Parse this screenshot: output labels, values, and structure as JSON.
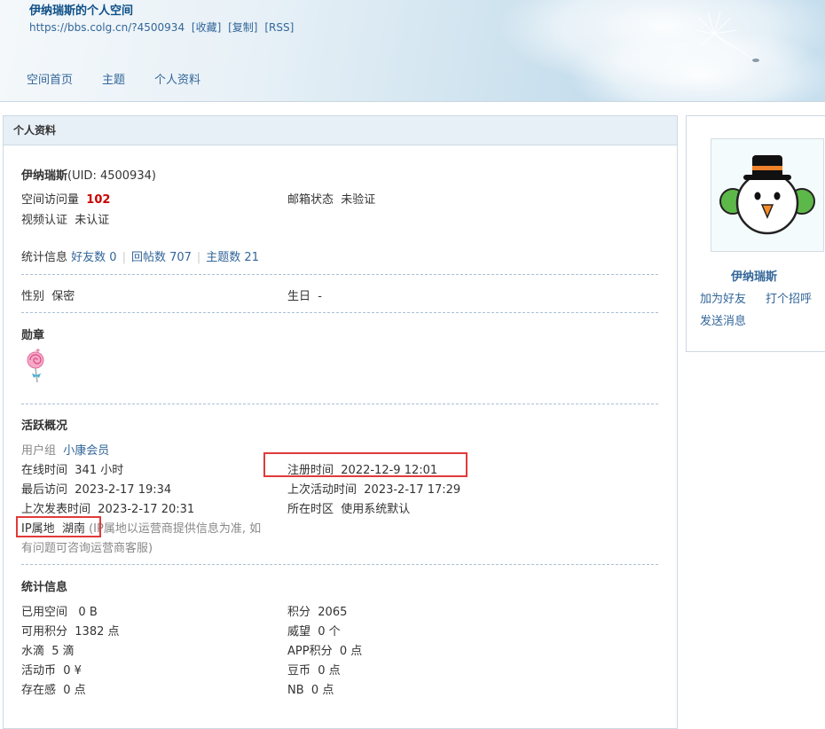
{
  "header": {
    "title": "伊纳瑞斯的个人空间",
    "url": "https://bbs.colg.cn/?4500934",
    "links": [
      "[收藏]",
      "[复制]",
      "[RSS]"
    ],
    "nav": [
      "空间首页",
      "主题",
      "个人资料"
    ]
  },
  "panel": {
    "heading": "个人资料",
    "username": "伊纳瑞斯",
    "uid": "(UID: 4500934)",
    "visits_label": "空间访问量",
    "visits_value": "102",
    "email_label": "邮箱状态",
    "email_value": "未验证",
    "video_label": "视频认证",
    "video_value": "未认证",
    "stats_label": "统计信息",
    "friends": "好友数 0",
    "replies": "回帖数 707",
    "topics": "主题数 21",
    "gender_label": "性别",
    "gender_value": "保密",
    "birthday_label": "生日",
    "birthday_value": "-",
    "medal_heading": "勋章",
    "activity_heading": "活跃概况",
    "usergroup_label": "用户组",
    "usergroup_value": "小康会员",
    "online_label": "在线时间",
    "online_value": "341 小时",
    "register_label": "注册时间",
    "register_value": "2022-12-9 12:01",
    "lastvisit_label": "最后访问",
    "lastvisit_value": "2023-2-17 19:34",
    "lastactive_label": "上次活动时间",
    "lastactive_value": "2023-2-17 17:29",
    "lastpost_label": "上次发表时间",
    "lastpost_value": "2023-2-17 20:31",
    "timezone_label": "所在时区",
    "timezone_value": "使用系统默认",
    "ip_label": "IP属地",
    "ip_value": "湖南",
    "ip_note_1": "(IP属地以运营商提供信息为准, 如",
    "ip_note_2": "有问题可咨询运营商客服)",
    "stats_heading": "统计信息",
    "used_space_label": "已用空间",
    "used_space_value": "0 B",
    "score_label": "积分",
    "score_value": "2065",
    "usable_label": "可用积分",
    "usable_value": "1382 点",
    "prestige_label": "威望",
    "prestige_value": "0 个",
    "water_label": "水滴",
    "water_value": "5 滴",
    "app_label": "APP积分",
    "app_value": "0 点",
    "coin_label": "活动币",
    "coin_value": "0 ¥",
    "bean_label": "豆币",
    "bean_value": "0 点",
    "presence_label": "存在感",
    "presence_value": "0 点",
    "nb_label": "NB",
    "nb_value": "0 点"
  },
  "sidebar": {
    "name": "伊纳瑞斯",
    "add_friend": "加为好友",
    "greet": "打个招呼",
    "message": "发送消息"
  },
  "colors": {
    "link": "#336699",
    "highlight_box": "#e03a3a",
    "visits": "#cc0000"
  }
}
